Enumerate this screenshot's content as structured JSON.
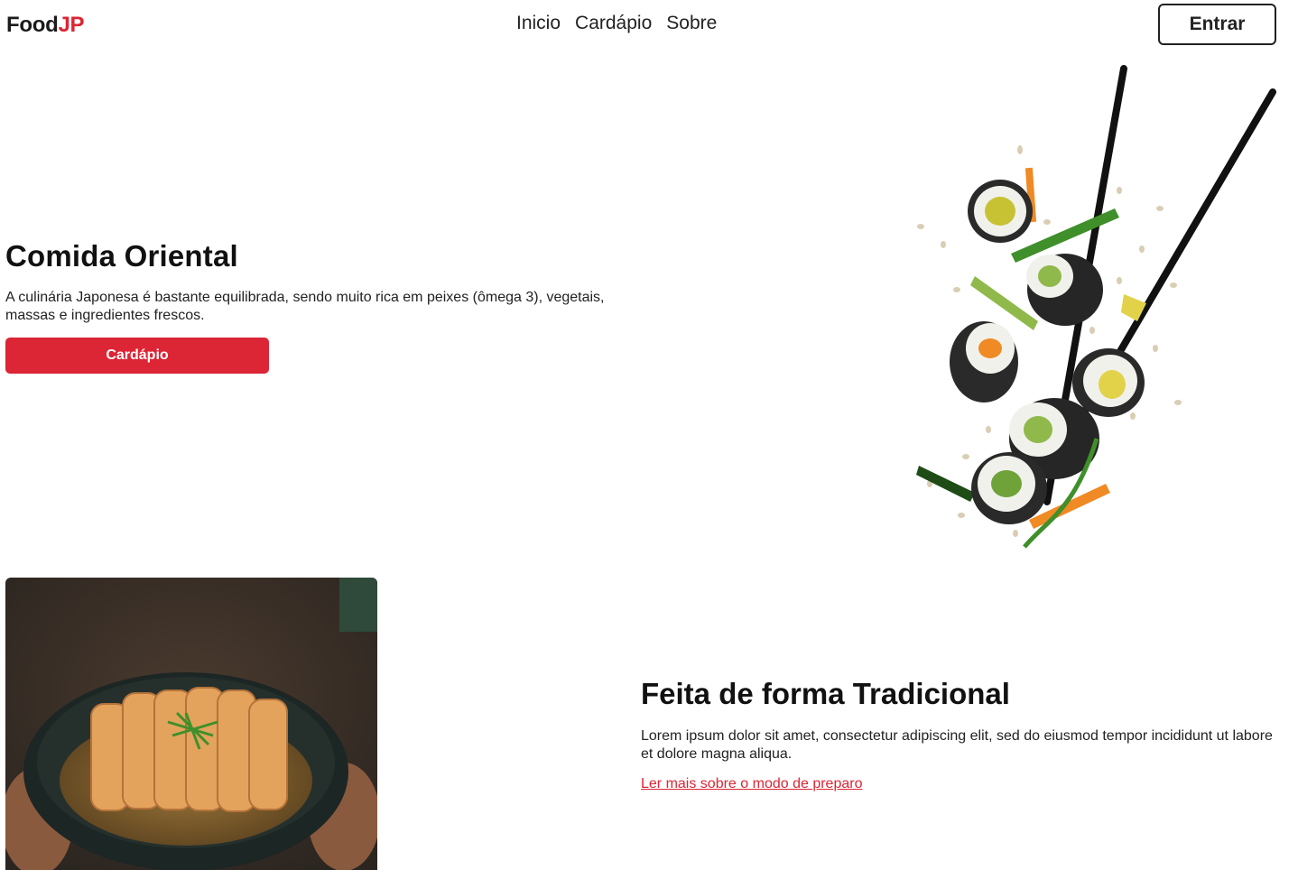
{
  "header": {
    "logo_part1": "Food",
    "logo_part2": "JP",
    "nav": [
      "Inicio",
      "Cardápio",
      "Sobre"
    ],
    "login_label": "Entrar"
  },
  "hero": {
    "title": "Comida Oriental",
    "description": "A culinária Japonesa é bastante equilibrada, sendo muito rica em peixes (ômega 3), vegetais, massas e ingredientes frescos.",
    "button_label": "Cardápio"
  },
  "feature": {
    "title": "Feita de forma Tradicional",
    "description": "Lorem ipsum dolor sit amet, consectetur adipiscing elit, sed do eiusmod tempor incididunt ut labore et dolore magna aliqua.",
    "link_label": "Ler mais sobre o modo de preparo"
  },
  "colors": {
    "accent": "#dc2535",
    "text": "#111111",
    "background": "#ffffff"
  }
}
